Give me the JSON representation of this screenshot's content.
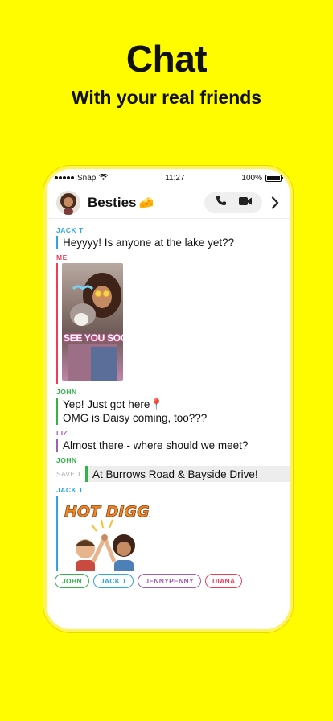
{
  "promo": {
    "title": "Chat",
    "subtitle": "With your real friends"
  },
  "status_bar": {
    "carrier": "Snap",
    "time": "11:27",
    "battery": "100%"
  },
  "header": {
    "chat_name": "Besties",
    "emoji": "🧀"
  },
  "messages": {
    "m1": {
      "sender": "JACK T",
      "text": "Heyyyy! Is anyone at the lake yet??"
    },
    "m2": {
      "sender": "ME",
      "snap_caption": "SEE YOU SOON!"
    },
    "m3": {
      "sender": "JOHN",
      "line1": "Yep! Just got here📍",
      "line2": "OMG is Daisy coming, too???"
    },
    "m4": {
      "sender": "LIZ",
      "text": "Almost there - where should we meet?"
    },
    "m5": {
      "sender": "JOHN",
      "saved_label": "SAVED",
      "text": "At Burrows Road & Bayside Drive!"
    },
    "m6": {
      "sender": "JACK T",
      "sticker_text": "HOT DIGGITY"
    }
  },
  "presence": [
    "JOHN",
    "JACK T",
    "JENNYPENNY",
    "DIANA"
  ],
  "colors": {
    "background": "#FFFC00",
    "jack": "#2EA7E0",
    "me": "#F23C57",
    "john": "#33B249",
    "liz": "#A05EB5"
  }
}
